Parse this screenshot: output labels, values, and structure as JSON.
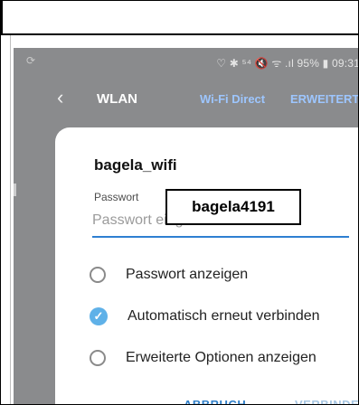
{
  "statusbar": {
    "left_icon": "sync-icon",
    "right_text": "♡ ✱ ⁵⁴ 🔇 ᯤ .ıl 95% ▮ 09:31"
  },
  "appbar": {
    "back_icon": "back-chevron-icon",
    "title": "WLAN",
    "action_wifi_direct": "Wi-Fi Direct",
    "action_advanced": "ERWEITERT"
  },
  "dialog": {
    "network_name": "bagela_wifi",
    "password_label": "Passwort",
    "password_placeholder": "Passwort eingeben",
    "password_overlay": "bagela4191",
    "options": [
      {
        "label": "Passwort anzeigen",
        "checked": false
      },
      {
        "label": "Automatisch erneut verbinden",
        "checked": true
      },
      {
        "label": "Erweiterte Optionen anzeigen",
        "checked": false
      }
    ],
    "cancel_label": "ABBRUCH",
    "connect_label": "VERBINDEN"
  },
  "colors": {
    "accent": "#2e7fd1",
    "checkbox": "#5fb1e8",
    "dim_overlay": "#8a8b8d"
  }
}
